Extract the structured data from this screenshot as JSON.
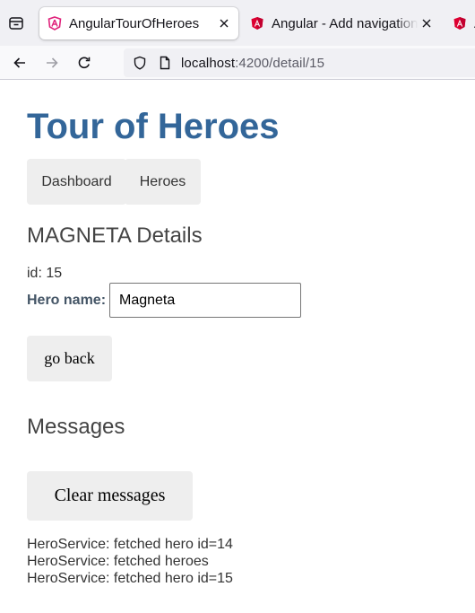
{
  "browser": {
    "tabs": [
      {
        "title": "AngularTourOfHeroes",
        "active": true
      },
      {
        "title": "Angular - Add navigation",
        "active": false
      },
      {
        "title": "A",
        "active": false
      }
    ],
    "url_host": "localhost",
    "url_path": ":4200/detail/15"
  },
  "app": {
    "title": "Tour of Heroes",
    "nav": [
      {
        "label": "Dashboard"
      },
      {
        "label": "Heroes"
      }
    ]
  },
  "detail": {
    "heading": "MAGNETA Details",
    "id_line": "id: 15",
    "name_label": "Hero name:",
    "name_value": "Magneta",
    "go_back_label": "go back"
  },
  "messages": {
    "heading": "Messages",
    "clear_label": "Clear messages",
    "items": [
      "HeroService: fetched hero id=14",
      "HeroService: fetched heroes",
      "HeroService: fetched hero id=15"
    ]
  },
  "colors": {
    "title_blue": "#336699",
    "button_bg": "#eeeeee",
    "angular_red": "#dd0031",
    "tab_active_icon": "#e0237c"
  },
  "icons": {
    "tab_list": "tab-list-icon",
    "angular": "angular-logo-icon",
    "close": "close-icon",
    "back": "back-arrow-icon",
    "forward": "forward-arrow-icon",
    "reload": "reload-icon",
    "shield": "shield-icon",
    "page": "page-icon"
  }
}
